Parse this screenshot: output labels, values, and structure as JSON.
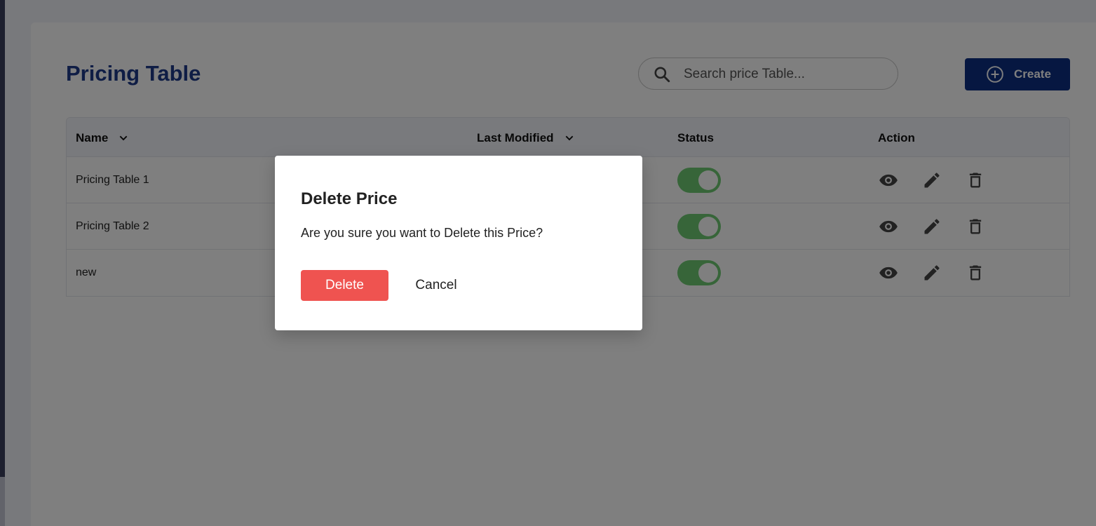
{
  "page": {
    "title": "Pricing Table"
  },
  "search": {
    "placeholder": "Search price Table...",
    "value": ""
  },
  "toolbar": {
    "create_label": "Create"
  },
  "table": {
    "columns": [
      {
        "label": "Name",
        "sortable": true
      },
      {
        "label": "Last Modified",
        "sortable": true
      },
      {
        "label": "Status",
        "sortable": false
      },
      {
        "label": "Action",
        "sortable": false
      }
    ],
    "rows": [
      {
        "name": "Pricing Table 1",
        "last_modified": "",
        "status_on": true
      },
      {
        "name": "Pricing Table 2",
        "last_modified": "",
        "status_on": true
      },
      {
        "name": "new",
        "last_modified": "",
        "status_on": true
      }
    ],
    "row_actions": [
      "eye-icon",
      "pencil-icon",
      "trash-icon"
    ]
  },
  "dialog": {
    "title": "Delete Price",
    "message": "Are you sure you want to Delete this Price?",
    "confirm_label": "Delete",
    "cancel_label": "Cancel"
  },
  "colors": {
    "brand": "#0d2f82",
    "title": "#1e3a8a",
    "toggle_on": "#6ecb73",
    "danger": "#ef5350"
  }
}
